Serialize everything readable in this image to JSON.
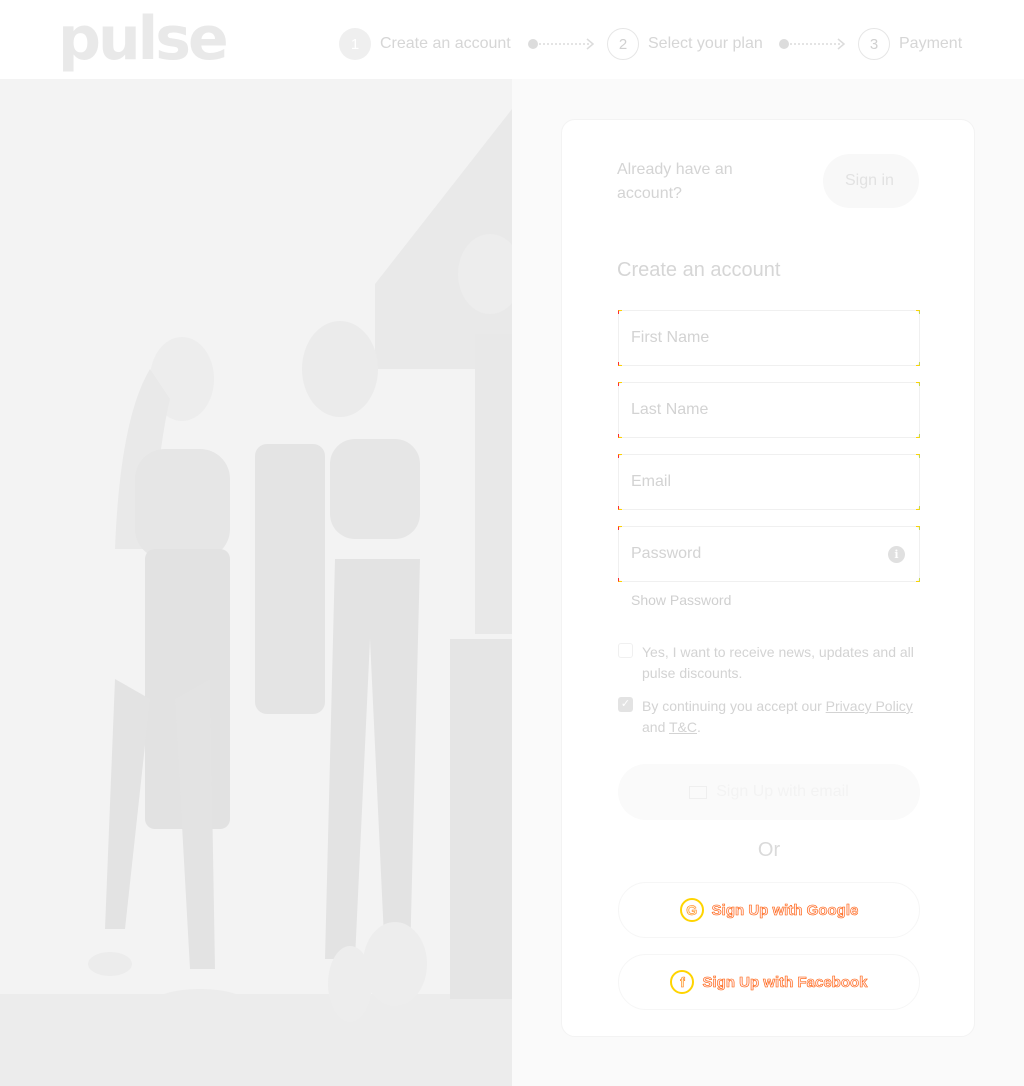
{
  "brand": {
    "logo_text": "pulse"
  },
  "steps": [
    {
      "number": "1",
      "label": "Create an account",
      "state": "active"
    },
    {
      "number": "2",
      "label": "Select your plan",
      "state": "upcoming"
    },
    {
      "number": "3",
      "label": "Payment",
      "state": "upcoming"
    }
  ],
  "signin": {
    "prompt": "Already have an account?",
    "button_label": "Sign in"
  },
  "form": {
    "title": "Create an account",
    "first_name": {
      "placeholder": "First Name",
      "value": ""
    },
    "last_name": {
      "placeholder": "Last Name",
      "value": ""
    },
    "email": {
      "placeholder": "Email",
      "value": ""
    },
    "password": {
      "placeholder": "Password",
      "value": "",
      "info_icon": "info-icon"
    },
    "show_password_label": "Show Password",
    "newsletter": {
      "checked": false,
      "label": "Yes, I want to receive news, updates and all pulse discounts."
    },
    "terms": {
      "checked": true,
      "prefix": "By continuing you accept our ",
      "privacy_link": "Privacy Policy",
      "middle": " and ",
      "tc_link": "T&C",
      "suffix": "."
    },
    "email_button_label": "Sign Up with email",
    "or_label": "Or",
    "google_button_label": "Sign Up with Google",
    "facebook_button_label": "Sign Up with Facebook"
  },
  "colors": {
    "accent_outline": "#ff5a00",
    "accent_yellow": "#ffd400"
  }
}
